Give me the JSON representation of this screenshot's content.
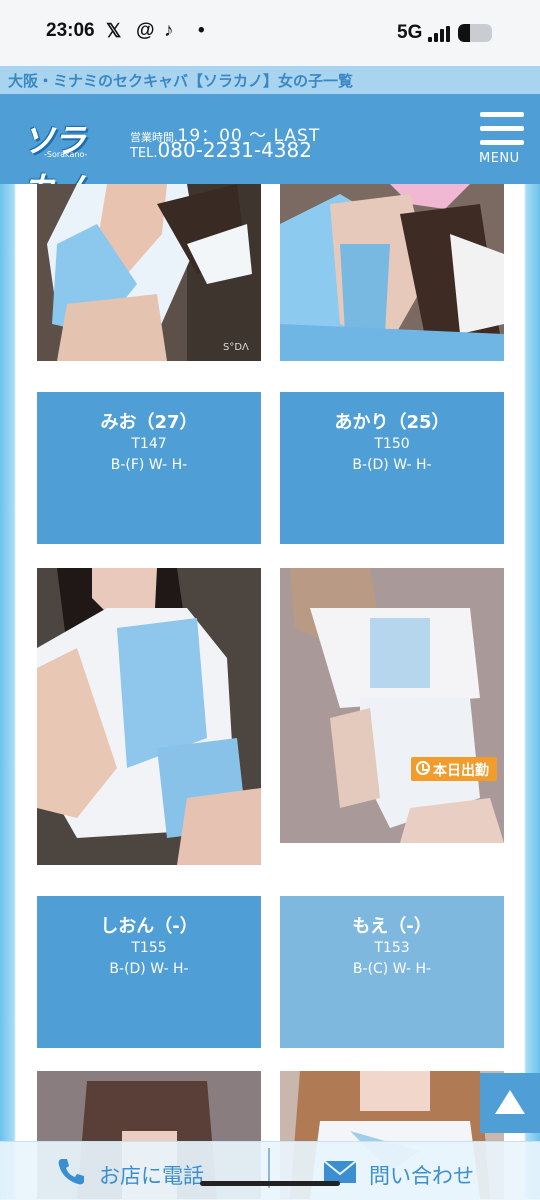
{
  "status_bar": {
    "time": "23:06",
    "app_icons": [
      "X",
      "Threads",
      "TikTok",
      "•"
    ],
    "network": "5G",
    "battery_level": 0.35
  },
  "banner": {
    "title": "大阪・ミナミのセクキャバ【ソラカノ】女の子一覧"
  },
  "header": {
    "logo_text": "ソラカノ",
    "logo_sub": "-Sorakano-",
    "hours_label": "営業時間.",
    "hours_value": "19：00 ～ LAST",
    "tel_label": "TEL.",
    "tel_value": "080-2231-4382",
    "menu_label": "MENU"
  },
  "photo_watermark": "S°DΛ",
  "cards": [
    {
      "name": "みお（27）",
      "height": "T147",
      "sizes": "B-(F) W- H-"
    },
    {
      "name": "あかり（25）",
      "height": "T150",
      "sizes": "B-(D) W- H-"
    },
    {
      "name": "しおん（-）",
      "height": "T155",
      "sizes": "B-(D) W- H-"
    },
    {
      "name": "もえ（-）",
      "height": "T153",
      "sizes": "B-(C) W- H-"
    }
  ],
  "badge": {
    "label": "本日出勤",
    "icon": "clock-icon"
  },
  "footer": {
    "call_label": "お店に電話",
    "contact_label": "問い合わせ",
    "call_icon": "phone-icon",
    "contact_icon": "mail-icon"
  },
  "colors": {
    "header": "#4f9fd6",
    "card": "#4f9fd6",
    "card_light": "#7fb8df",
    "badge": "#f29c2b",
    "banner_text": "#3b87c4"
  }
}
